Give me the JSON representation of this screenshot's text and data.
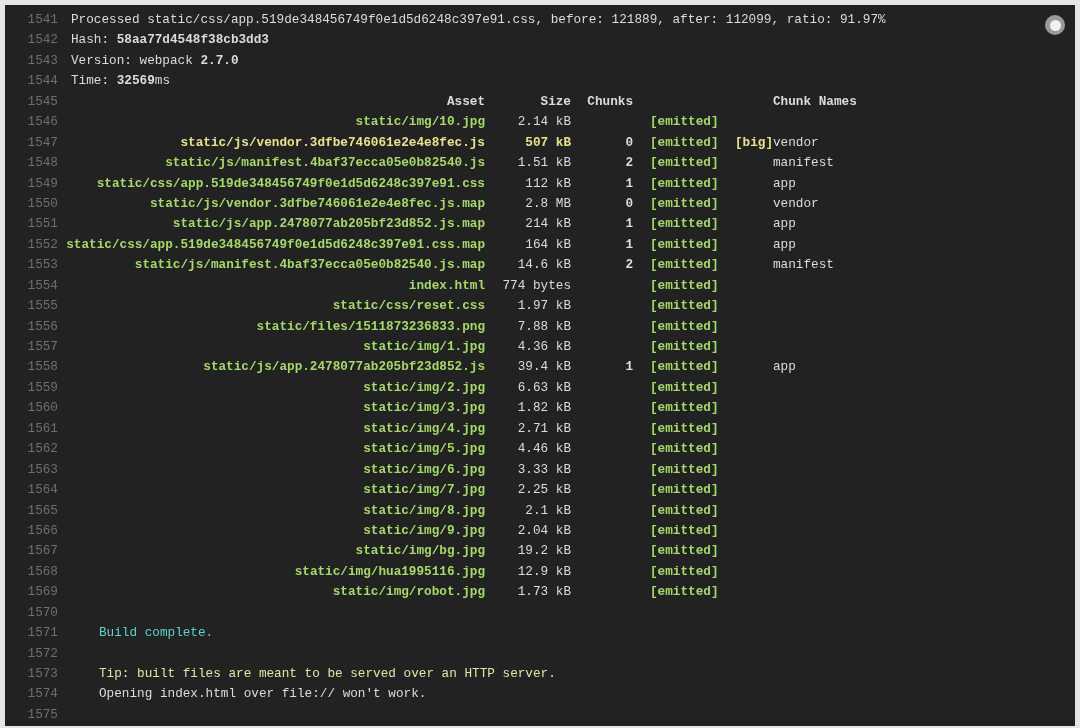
{
  "lines": [
    {
      "number": "1541",
      "kind": "info",
      "text": "Processed static/css/app.519de348456749f0e1d5d6248c397e91.css, before: 121889, after: 112099, ratio: 91.97%"
    },
    {
      "number": "1542",
      "kind": "info",
      "text": "Hash: **58aa77d4548f38cb3dd3**"
    },
    {
      "number": "1543",
      "kind": "info",
      "text": "Version: webpack **2.7.0**"
    },
    {
      "number": "1544",
      "kind": "info",
      "text": "Time: **32569**ms"
    },
    {
      "number": "1545",
      "kind": "header",
      "asset": "Asset",
      "size": "Size",
      "chunks": "Chunks",
      "chunk_names": "Chunk Names"
    },
    {
      "number": "1546",
      "kind": "asset",
      "asset": "static/img/10.jpg",
      "size": "2.14 kB",
      "status": "[emitted]",
      "big": false
    },
    {
      "number": "1547",
      "kind": "asset",
      "asset": "static/js/vendor.3dfbe746061e2e4e8fec.js",
      "size": "507 kB",
      "chunks": "0",
      "status": "[emitted]",
      "flag": "[big]",
      "chunk_names": "vendor",
      "big": true
    },
    {
      "number": "1548",
      "kind": "asset",
      "asset": "static/js/manifest.4baf37ecca05e0b82540.js",
      "size": "1.51 kB",
      "chunks": "2",
      "status": "[emitted]",
      "chunk_names": "manifest",
      "big": false
    },
    {
      "number": "1549",
      "kind": "asset",
      "asset": "static/css/app.519de348456749f0e1d5d6248c397e91.css",
      "size": "112 kB",
      "chunks": "1",
      "status": "[emitted]",
      "chunk_names": "app",
      "big": false
    },
    {
      "number": "1550",
      "kind": "asset",
      "asset": "static/js/vendor.3dfbe746061e2e4e8fec.js.map",
      "size": "2.8 MB",
      "chunks": "0",
      "status": "[emitted]",
      "chunk_names": "vendor",
      "big": false
    },
    {
      "number": "1551",
      "kind": "asset",
      "asset": "static/js/app.2478077ab205bf23d852.js.map",
      "size": "214 kB",
      "chunks": "1",
      "status": "[emitted]",
      "chunk_names": "app",
      "big": false
    },
    {
      "number": "1552",
      "kind": "asset",
      "asset": "static/css/app.519de348456749f0e1d5d6248c397e91.css.map",
      "size": "164 kB",
      "chunks": "1",
      "status": "[emitted]",
      "chunk_names": "app",
      "big": false
    },
    {
      "number": "1553",
      "kind": "asset",
      "asset": "static/js/manifest.4baf37ecca05e0b82540.js.map",
      "size": "14.6 kB",
      "chunks": "2",
      "status": "[emitted]",
      "chunk_names": "manifest",
      "big": false
    },
    {
      "number": "1554",
      "kind": "asset",
      "asset": "index.html",
      "size": "774 bytes",
      "status": "[emitted]",
      "big": false
    },
    {
      "number": "1555",
      "kind": "asset",
      "asset": "static/css/reset.css",
      "size": "1.97 kB",
      "status": "[emitted]",
      "big": false
    },
    {
      "number": "1556",
      "kind": "asset",
      "asset": "static/files/1511873236833.png",
      "size": "7.88 kB",
      "status": "[emitted]",
      "big": false
    },
    {
      "number": "1557",
      "kind": "asset",
      "asset": "static/img/1.jpg",
      "size": "4.36 kB",
      "status": "[emitted]",
      "big": false
    },
    {
      "number": "1558",
      "kind": "asset",
      "asset": "static/js/app.2478077ab205bf23d852.js",
      "size": "39.4 kB",
      "chunks": "1",
      "status": "[emitted]",
      "chunk_names": "app",
      "big": false
    },
    {
      "number": "1559",
      "kind": "asset",
      "asset": "static/img/2.jpg",
      "size": "6.63 kB",
      "status": "[emitted]",
      "big": false
    },
    {
      "number": "1560",
      "kind": "asset",
      "asset": "static/img/3.jpg",
      "size": "1.82 kB",
      "status": "[emitted]",
      "big": false
    },
    {
      "number": "1561",
      "kind": "asset",
      "asset": "static/img/4.jpg",
      "size": "2.71 kB",
      "status": "[emitted]",
      "big": false
    },
    {
      "number": "1562",
      "kind": "asset",
      "asset": "static/img/5.jpg",
      "size": "4.46 kB",
      "status": "[emitted]",
      "big": false
    },
    {
      "number": "1563",
      "kind": "asset",
      "asset": "static/img/6.jpg",
      "size": "3.33 kB",
      "status": "[emitted]",
      "big": false
    },
    {
      "number": "1564",
      "kind": "asset",
      "asset": "static/img/7.jpg",
      "size": "2.25 kB",
      "status": "[emitted]",
      "big": false
    },
    {
      "number": "1565",
      "kind": "asset",
      "asset": "static/img/8.jpg",
      "size": "2.1 kB",
      "status": "[emitted]",
      "big": false
    },
    {
      "number": "1566",
      "kind": "asset",
      "asset": "static/img/9.jpg",
      "size": "2.04 kB",
      "status": "[emitted]",
      "big": false
    },
    {
      "number": "1567",
      "kind": "asset",
      "asset": "static/img/bg.jpg",
      "size": "19.2 kB",
      "status": "[emitted]",
      "big": false
    },
    {
      "number": "1568",
      "kind": "asset",
      "asset": "static/img/hua1995116.jpg",
      "size": "12.9 kB",
      "status": "[emitted]",
      "big": false
    },
    {
      "number": "1569",
      "kind": "asset",
      "asset": "static/img/robot.jpg",
      "size": "1.73 kB",
      "status": "[emitted]",
      "big": false
    },
    {
      "number": "1570",
      "kind": "blank"
    },
    {
      "number": "1571",
      "kind": "success",
      "text": "Build complete."
    },
    {
      "number": "1572",
      "kind": "blank"
    },
    {
      "number": "1573",
      "kind": "tip",
      "text": "Tip: built files are meant to be served over an HTTP server."
    },
    {
      "number": "1574",
      "kind": "plain",
      "text": "Opening index.html over file:// won't work."
    },
    {
      "number": "1575",
      "kind": "blank"
    }
  ]
}
